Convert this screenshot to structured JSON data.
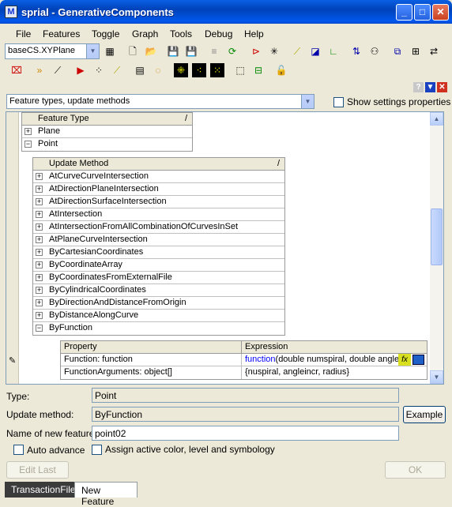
{
  "window": {
    "title": "sprial - GenerativeComponents",
    "app_icon": "app-icon"
  },
  "menu": [
    "File",
    "Features",
    "Toggle",
    "Graph",
    "Tools",
    "Debug",
    "Help"
  ],
  "toolbar": {
    "plane_select": "baseCS.XYPlane"
  },
  "filter": {
    "selected": "Feature types, update methods",
    "show_settings": "Show settings properties"
  },
  "tree": {
    "feature_header": "Feature Type",
    "feature_slash": "/",
    "feature_types": [
      "Plane",
      "Point"
    ],
    "method_header": "Update Method",
    "method_slash": "/",
    "methods": [
      "AtCurveCurveIntersection",
      "AtDirectionPlaneIntersection",
      "AtDirectionSurfaceIntersection",
      "AtIntersection",
      "AtIntersectionFromAllCombinationOfCurvesInSet",
      "AtPlaneCurveIntersection",
      "ByCartesianCoordinates",
      "ByCoordinateArray",
      "ByCoordinatesFromExternalFile",
      "ByCylindricalCoordinates",
      "ByDirectionAndDistanceFromOrigin",
      "ByDistanceAlongCurve",
      "ByFunction"
    ],
    "prop_headers": {
      "property": "Property",
      "expression": "Expression"
    },
    "props": [
      {
        "property": "Function: function",
        "expr_keyword": "function",
        "expr_rest": "(double numspiral, double angle"
      },
      {
        "property": "FunctionArguments: object[]",
        "expr_keyword": "",
        "expr_rest": "{nuspiral, angleincr, radius}"
      }
    ],
    "fx_label": "fx"
  },
  "form": {
    "type_label": "Type:",
    "type_value": "Point",
    "method_label": "Update method:",
    "method_value": "ByFunction",
    "example_button": "Example",
    "name_label": "Name of new feature:",
    "name_value": "point02",
    "auto_advance": "Auto advance",
    "assign_active": "Assign active color, level and symbology",
    "edit_last": "Edit Last",
    "ok": "OK"
  },
  "tabs": [
    "TransactionFile",
    "New Feature"
  ],
  "colors": {
    "keyword": "#0000ff",
    "titlebar": "#0054e3"
  }
}
